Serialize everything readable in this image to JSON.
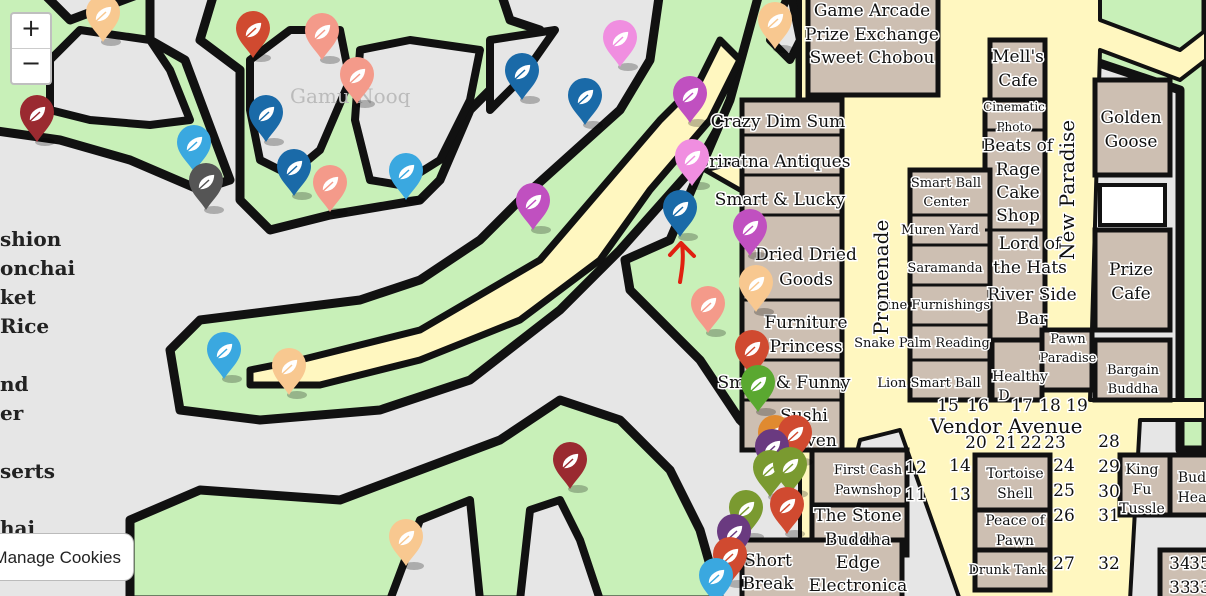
{
  "controls": {
    "zoom_in": "+",
    "zoom_out": "−",
    "manage_cookies": "Manage Cookies"
  },
  "colors": {
    "grass": "#c8f0b8",
    "building": "#cdbfb2",
    "street": "#fff7c0",
    "water": "#e6e6e6",
    "outline": "#111111"
  },
  "left_list": [
    "shion",
    "onchai",
    "ket",
    "Rice",
    "nd",
    "er",
    "serts",
    "hai"
  ],
  "faint_label": "Gamu Nooq",
  "shops": [
    "Game Arcade",
    "Prize Exchange",
    "Sweet Chobou",
    "Crazy Dim Sum",
    "Sriratna Antiques",
    "Smart & Lucky",
    "Dried Dried",
    "Goods",
    "Furniture",
    "Princess",
    "Smart & Funny",
    "Sushi",
    "Heaven",
    "The Stone",
    "Buddha",
    "Short",
    "Break",
    "Edge",
    "Electronica",
    "Mell's",
    "Cafe",
    "Cinematic",
    "Photo",
    "Beats of",
    "Rage",
    "Cake",
    "Shop",
    "Lord of",
    "the Hats",
    "River Side",
    "Bar",
    "Smart Ball",
    "Center",
    "Muren Yard",
    "Saramanda",
    "Fine Furnishings",
    "Snake Palm Reading",
    "Lion Smart Ball",
    "Healthy",
    "D",
    "Pawn",
    "Paradise",
    "Golden",
    "Goose",
    "Prize",
    "Cafe",
    "Bargain",
    "Buddha",
    "First Cash",
    "Pawnshop",
    "Tortoise",
    "Shell",
    "Peace of",
    "Pawn",
    "Drunk Tank",
    "King",
    "Fu",
    "Tussle",
    "Bud",
    "Hea"
  ],
  "streets": [
    "Promenade",
    "New Paradise",
    "Vendor Avenue"
  ],
  "lot_numbers": [
    "15",
    "16",
    "17",
    "18",
    "19",
    "20",
    "21",
    "22",
    "23",
    "12",
    "11",
    "14",
    "13",
    "24",
    "25",
    "26",
    "27",
    "28",
    "29",
    "30",
    "31",
    "32",
    "34",
    "33",
    "35",
    "33"
  ],
  "markers": [
    {
      "color": "#f8c890",
      "icon": "leaf-icon"
    },
    {
      "color": "#d04a30",
      "icon": "leaf-icon"
    },
    {
      "color": "#f49a8a",
      "icon": "leaf-icon"
    },
    {
      "color": "#f49a8a",
      "icon": "leaf-icon"
    },
    {
      "color": "#9a2a30",
      "icon": "leaf-icon"
    },
    {
      "color": "#1a6aa8",
      "icon": "leaf-icon"
    },
    {
      "color": "#3aa8e0",
      "icon": "leaf-icon"
    },
    {
      "color": "#555555",
      "icon": "leaf-icon"
    },
    {
      "color": "#1a6aa8",
      "icon": "leaf-icon"
    },
    {
      "color": "#f49a8a",
      "icon": "leaf-icon"
    },
    {
      "color": "#3aa8e0",
      "icon": "leaf-icon"
    },
    {
      "color": "#1a6aa8",
      "icon": "leaf-icon"
    },
    {
      "color": "#1a6aa8",
      "icon": "leaf-icon"
    },
    {
      "color": "#f08ee0",
      "icon": "leaf-icon"
    },
    {
      "color": "#c050c0",
      "icon": "leaf-icon"
    },
    {
      "color": "#f08ee0",
      "icon": "leaf-icon"
    },
    {
      "color": "#c050c0",
      "icon": "leaf-icon"
    },
    {
      "color": "#1a6aa8",
      "icon": "leaf-icon"
    },
    {
      "color": "#c050c0",
      "icon": "leaf-icon"
    },
    {
      "color": "#f8c890",
      "icon": "leaf-icon"
    },
    {
      "color": "#f49a8a",
      "icon": "leaf-icon"
    },
    {
      "color": "#f8c890",
      "icon": "leaf-icon"
    },
    {
      "color": "#d04a30",
      "icon": "leaf-icon"
    },
    {
      "color": "#5aa830",
      "icon": "leaf-icon"
    },
    {
      "color": "#3aa8e0",
      "icon": "leaf-icon"
    },
    {
      "color": "#f8c890",
      "icon": "leaf-icon"
    },
    {
      "color": "#9a2a30",
      "icon": "leaf-icon"
    },
    {
      "color": "#f8c890",
      "icon": "leaf-icon"
    },
    {
      "color": "#e08a30",
      "icon": "leaf-icon"
    },
    {
      "color": "#d04a30",
      "icon": "leaf-icon"
    },
    {
      "color": "#6a3a80",
      "icon": "leaf-icon"
    },
    {
      "color": "#7a9a30",
      "icon": "leaf-icon"
    },
    {
      "color": "#7a9a30",
      "icon": "leaf-icon"
    },
    {
      "color": "#7a9a30",
      "icon": "leaf-icon"
    },
    {
      "color": "#d04a30",
      "icon": "leaf-icon"
    },
    {
      "color": "#6a3a80",
      "icon": "leaf-icon"
    },
    {
      "color": "#d04a30",
      "icon": "leaf-icon"
    },
    {
      "color": "#3aa8e0",
      "icon": "leaf-icon"
    }
  ],
  "annotation": {
    "icon": "red-arrow-icon",
    "color": "#e02010"
  }
}
